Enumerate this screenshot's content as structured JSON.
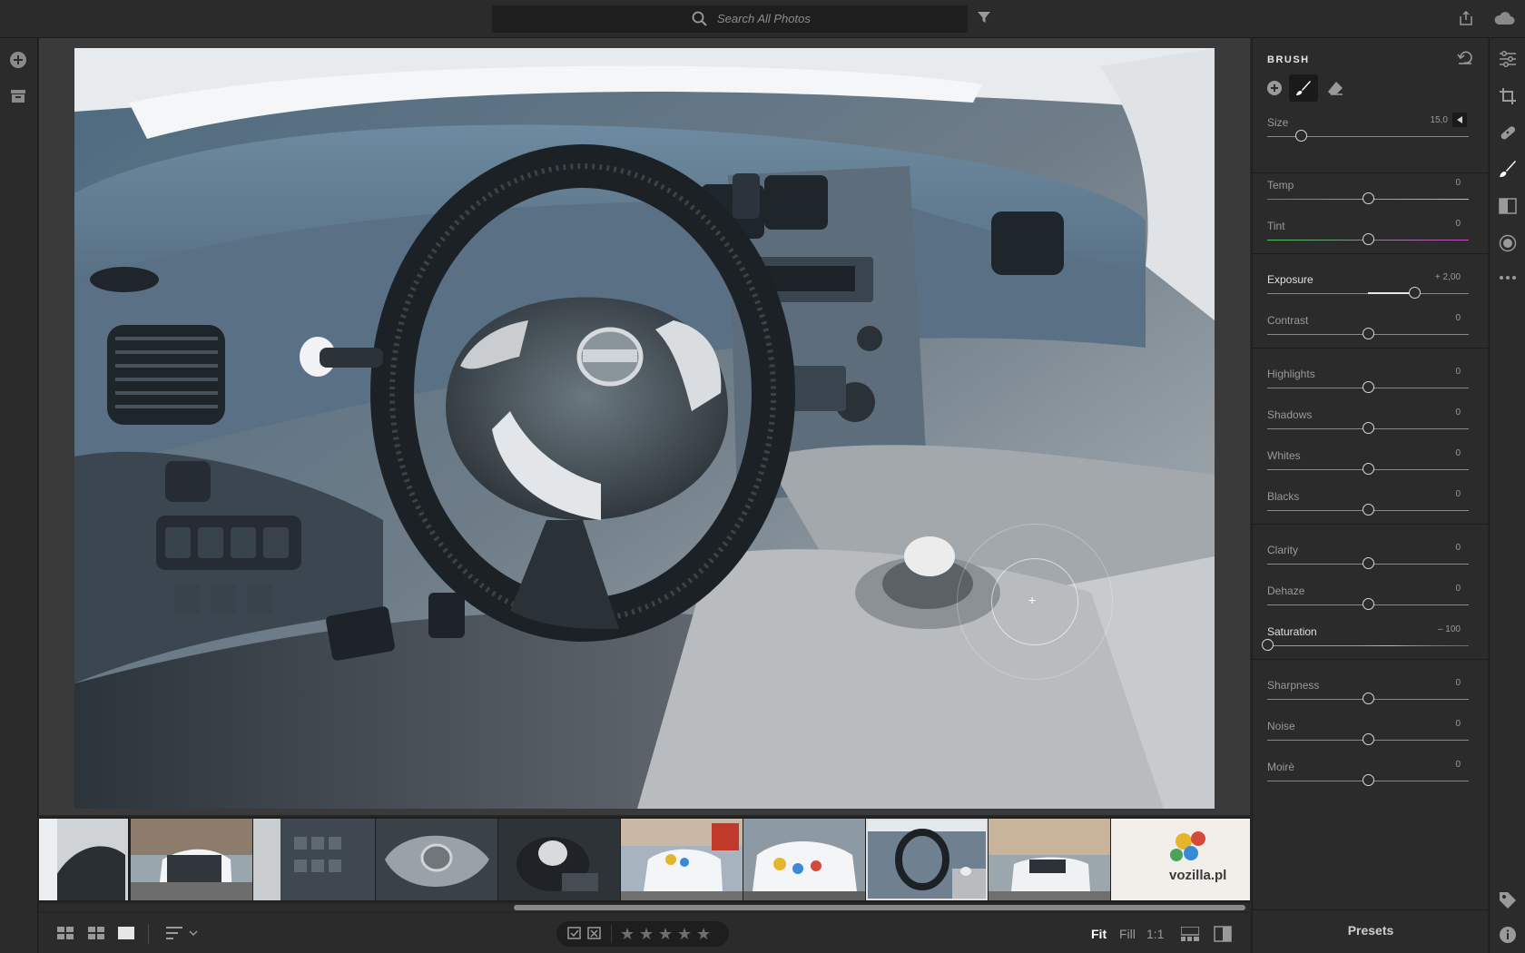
{
  "search": {
    "placeholder": "Search All Photos"
  },
  "panel": {
    "title": "BRUSH",
    "size": {
      "label": "Size",
      "value": "15,0",
      "level": 0.17
    },
    "groups": [
      [
        {
          "label": "Temp",
          "value": "0",
          "level": 0.5,
          "key": "temp"
        },
        {
          "label": "Tint",
          "value": "0",
          "level": 0.5,
          "key": "tint"
        }
      ],
      [
        {
          "label": "Exposure",
          "value": "+ 2,00",
          "level": 0.73,
          "key": "exposure",
          "highlight": true
        },
        {
          "label": "Contrast",
          "value": "0",
          "level": 0.5,
          "key": "contrast"
        }
      ],
      [
        {
          "label": "Highlights",
          "value": "0",
          "level": 0.5,
          "key": "highlights"
        },
        {
          "label": "Shadows",
          "value": "0",
          "level": 0.5,
          "key": "shadows"
        },
        {
          "label": "Whites",
          "value": "0",
          "level": 0.5,
          "key": "whites"
        },
        {
          "label": "Blacks",
          "value": "0",
          "level": 0.5,
          "key": "blacks"
        }
      ],
      [
        {
          "label": "Clarity",
          "value": "0",
          "level": 0.5,
          "key": "clarity"
        },
        {
          "label": "Dehaze",
          "value": "0",
          "level": 0.5,
          "key": "dehaze"
        },
        {
          "label": "Saturation",
          "value": "– 100",
          "level": 0.0,
          "key": "saturation",
          "highlight": true
        }
      ],
      [
        {
          "label": "Sharpness",
          "value": "0",
          "level": 0.5,
          "key": "sharpness"
        },
        {
          "label": "Noise",
          "value": "0",
          "level": 0.5,
          "key": "noise"
        },
        {
          "label": "Moirè",
          "value": "0",
          "level": 0.5,
          "key": "moire"
        }
      ]
    ],
    "presets_label": "Presets"
  },
  "bottombar": {
    "zoom": {
      "fit": "Fit",
      "fill": "Fill",
      "one_to_one": "1:1",
      "active": "Fit"
    },
    "rating_stars": 5
  },
  "filmstrip": {
    "selected_index": 7,
    "last_thumb_text": "vozilla.pl"
  },
  "colors": {
    "panel_bg": "#2b2b2b",
    "accent_text": "#e6e6e6",
    "saturation_gradient": [
      "#c0c0c0",
      "#d6413a"
    ],
    "temp_gradient": [
      "#4a7fc7",
      "#d6c34a"
    ],
    "tint_gradient": [
      "#4ac75a",
      "#c74ac2"
    ]
  }
}
